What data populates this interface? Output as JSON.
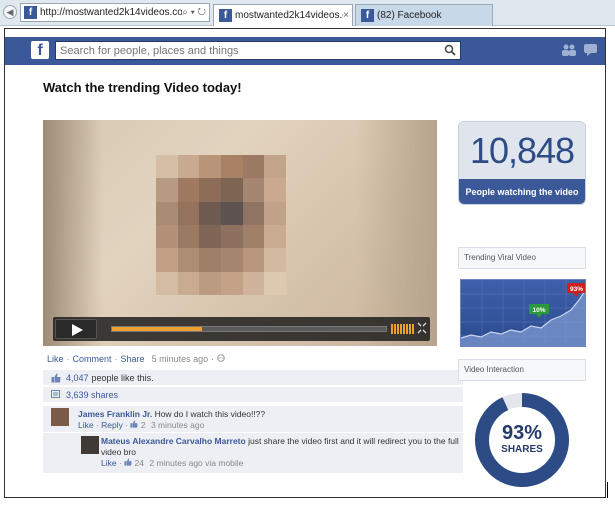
{
  "browser": {
    "address": "http://mostwanted2k14videos.com",
    "address_icons": "⌕ ▾ ↻",
    "tabs": [
      {
        "label": "mostwanted2k14videos.com",
        "close": "×"
      },
      {
        "label": "(82) Facebook"
      }
    ]
  },
  "header": {
    "logo": "f",
    "search_placeholder": "Search for people, places and things"
  },
  "page": {
    "title": "Watch the trending Video today!"
  },
  "video": {
    "progress": 0.33
  },
  "post": {
    "actions": [
      "Like",
      "Comment",
      "Share"
    ],
    "timestamp": "5 minutes ago",
    "likes_count": "4,047",
    "likes_text": "people like this.",
    "shares_text": "3,639 shares"
  },
  "comments": [
    {
      "author": "James Franklin Jr.",
      "text": "How do I watch this video!!??",
      "like": "Like",
      "reply": "Reply",
      "like_count": "2",
      "time": "3 minutes ago"
    },
    {
      "author": "Mateus Alexandre Carvalho Marreto",
      "text": "just share the video first and it will redirect you to the full video bro",
      "like": "Like",
      "like_count": "24",
      "time": "2 minutes ago via mobile"
    }
  ],
  "sidebar": {
    "viewer_count": "10,848",
    "viewer_label": "People watching the video",
    "trending_heading": "Trending Viral Video",
    "trend_high": "93%",
    "trend_low": "10%",
    "interaction_heading": "Video Interaction",
    "interaction_percent": "93%",
    "interaction_label": "SHARES",
    "interaction_value": 0.93
  },
  "colors": {
    "facebook_blue": "#3b5998",
    "share_ring": "#2d4b85",
    "progress": "#f0a030"
  }
}
